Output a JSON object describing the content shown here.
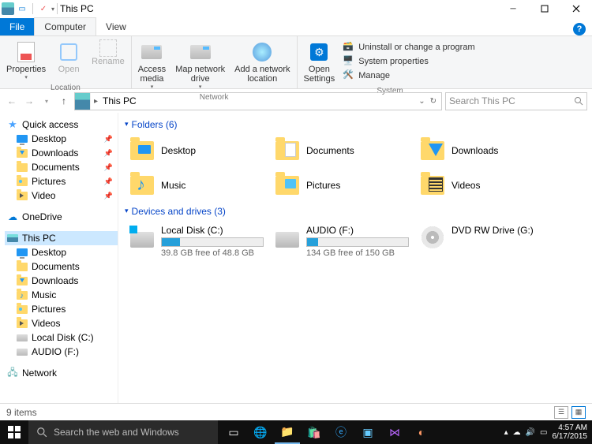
{
  "title": "This PC",
  "ribbon": {
    "tabs": {
      "file": "File",
      "computer": "Computer",
      "view": "View"
    },
    "location": {
      "label": "Location",
      "properties": "Properties",
      "open": "Open",
      "rename": "Rename"
    },
    "network": {
      "label": "Network",
      "access_media": "Access\nmedia",
      "map_drive": "Map network\ndrive",
      "add_loc": "Add a network\nlocation"
    },
    "system": {
      "label": "System",
      "open_settings": "Open\nSettings",
      "uninstall": "Uninstall or change a program",
      "sysprops": "System properties",
      "manage": "Manage"
    }
  },
  "breadcrumb": {
    "root": "This PC"
  },
  "search": {
    "placeholder": "Search This PC"
  },
  "tree": {
    "quick_access": "Quick access",
    "qa_items": [
      {
        "label": "Desktop"
      },
      {
        "label": "Downloads"
      },
      {
        "label": "Documents"
      },
      {
        "label": "Pictures"
      },
      {
        "label": "Video"
      }
    ],
    "onedrive": "OneDrive",
    "this_pc": "This PC",
    "pc_items": [
      {
        "label": "Desktop"
      },
      {
        "label": "Documents"
      },
      {
        "label": "Downloads"
      },
      {
        "label": "Music"
      },
      {
        "label": "Pictures"
      },
      {
        "label": "Videos"
      },
      {
        "label": "Local Disk (C:)"
      },
      {
        "label": "AUDIO (F:)"
      }
    ],
    "network": "Network"
  },
  "content": {
    "folders_header": "Folders (6)",
    "folders": [
      {
        "label": "Desktop",
        "kind": "desktop"
      },
      {
        "label": "Documents",
        "kind": "doc"
      },
      {
        "label": "Downloads",
        "kind": "dl"
      },
      {
        "label": "Music",
        "kind": "music"
      },
      {
        "label": "Pictures",
        "kind": "pic"
      },
      {
        "label": "Videos",
        "kind": "vid"
      }
    ],
    "drives_header": "Devices and drives (3)",
    "drives": [
      {
        "label": "Local Disk (C:)",
        "sub": "39.8 GB free of 48.8 GB",
        "pct": 18,
        "kind": "win"
      },
      {
        "label": "AUDIO (F:)",
        "sub": "134 GB free of 150 GB",
        "pct": 11,
        "kind": "hdd"
      },
      {
        "label": "DVD RW Drive (G:)",
        "sub": "",
        "pct": -1,
        "kind": "dvd"
      }
    ]
  },
  "status": {
    "text": "9 items"
  },
  "taskbar": {
    "search_placeholder": "Search the web and Windows",
    "time": "4:57 AM",
    "date": "6/17/2015"
  }
}
